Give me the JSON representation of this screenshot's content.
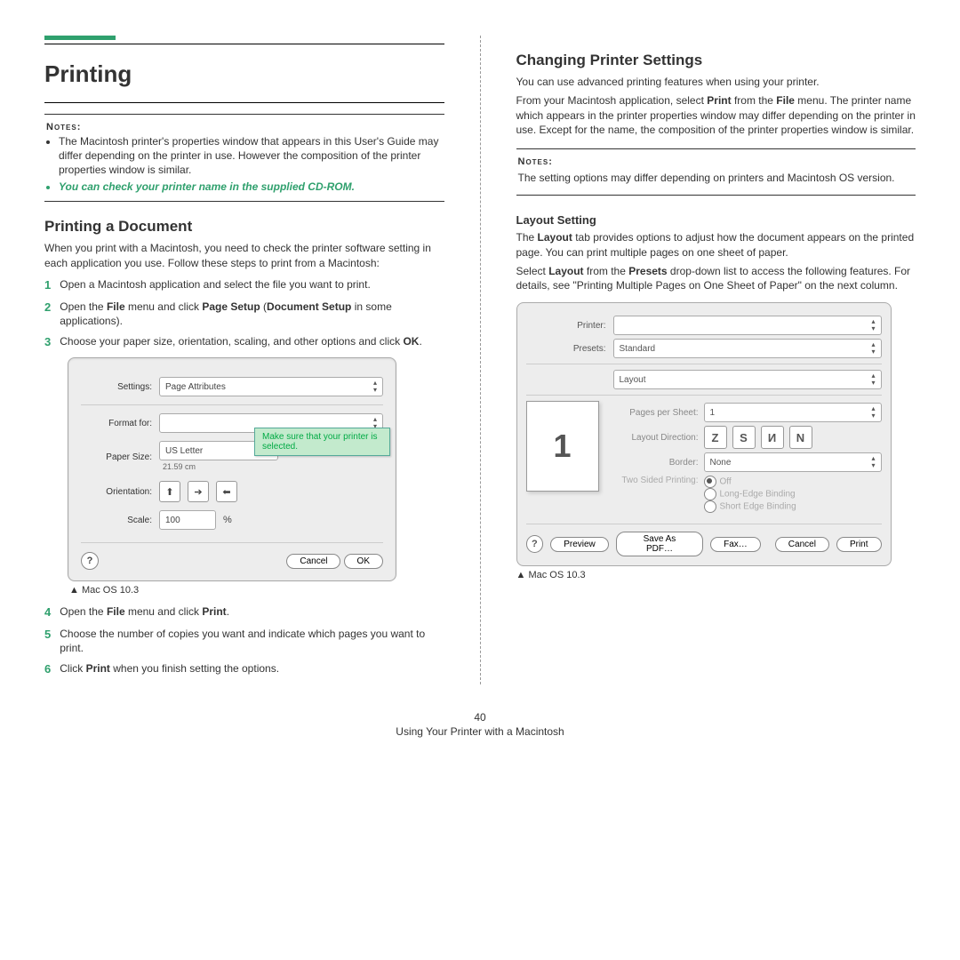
{
  "left": {
    "title": "Printing",
    "notes_label": "Notes:",
    "notes": [
      "The Macintosh printer's properties window that appears in this User's Guide may differ depending on the printer in use. However the composition of the printer properties window is similar.",
      "You can check your printer name in the supplied CD-ROM."
    ],
    "h2": "Printing a Document",
    "intro": "When you print with a Macintosh, you need to check the printer software setting in each application you use. Follow these steps to print from a Macintosh:",
    "steps": {
      "s1": "Open a Macintosh application and select the file you want to print.",
      "s2a": "Open the ",
      "s2b": "File",
      "s2c": " menu and click ",
      "s2d": "Page Setup",
      "s2e": " (",
      "s2f": "Document Setup",
      "s2g": " in some applications).",
      "s3a": "Choose your paper size, orientation, scaling, and other options and click ",
      "s3b": "OK",
      "s3c": ".",
      "s4a": "Open the ",
      "s4b": "File",
      "s4c": " menu and click ",
      "s4d": "Print",
      "s4e": ".",
      "s5": "Choose the number of copies you want and indicate which pages you want to print.",
      "s6a": "Click ",
      "s6b": "Print",
      "s6c": " when you finish setting the options."
    },
    "dlg": {
      "settings_lbl": "Settings:",
      "settings_val": "Page Attributes",
      "format_lbl": "Format for:",
      "paper_lbl": "Paper Size:",
      "paper_val": "US Letter",
      "paper_dim": "21.59 cm",
      "orient_lbl": "Orientation:",
      "scale_lbl": "Scale:",
      "scale_val": "100",
      "scale_pct": "%",
      "help": "?",
      "cancel": "Cancel",
      "ok": "OK",
      "tooltip": "Make sure that your printer is selected."
    },
    "caption": "Mac OS 10.3"
  },
  "right": {
    "h2": "Changing Printer Settings",
    "p1": "You can use advanced printing features when using your printer.",
    "p2a": "From your Macintosh application, select ",
    "p2b": "Print",
    "p2c": " from the ",
    "p2d": "File",
    "p2e": " menu. The printer name which appears in the printer properties window may differ depending on the printer in use. Except for the name, the composition of the printer properties window is similar.",
    "notes_label": "Notes:",
    "notes_body": "The setting options may differ depending on printers and Macintosh OS version.",
    "h3": "Layout Setting",
    "p3a": "The ",
    "p3b": "Layout",
    "p3c": " tab provides options to adjust how the document appears on the printed page. You can print multiple pages on one sheet of paper.",
    "p4a": "Select ",
    "p4b": "Layout",
    "p4c": " from the ",
    "p4d": "Presets",
    "p4e": " drop-down list to access the following features. For details, see \"Printing Multiple Pages on One Sheet of Paper\" on the next column.",
    "dlg": {
      "printer_lbl": "Printer:",
      "presets_lbl": "Presets:",
      "presets_val": "Standard",
      "layout_val": "Layout",
      "pps_lbl": "Pages per Sheet:",
      "pps_val": "1",
      "ld_lbl": "Layout Direction:",
      "border_lbl": "Border:",
      "border_val": "None",
      "ts_lbl": "Two Sided Printing:",
      "ts_off": "Off",
      "ts_long": "Long-Edge Binding",
      "ts_short": "Short Edge Binding",
      "help": "?",
      "preview": "Preview",
      "savepdf": "Save As PDF…",
      "fax": "Fax…",
      "cancel": "Cancel",
      "print": "Print",
      "tile": "1"
    },
    "caption": "Mac OS 10.3"
  },
  "footer": {
    "page_number": "40",
    "chapter": "Using Your Printer with a Macintosh"
  }
}
